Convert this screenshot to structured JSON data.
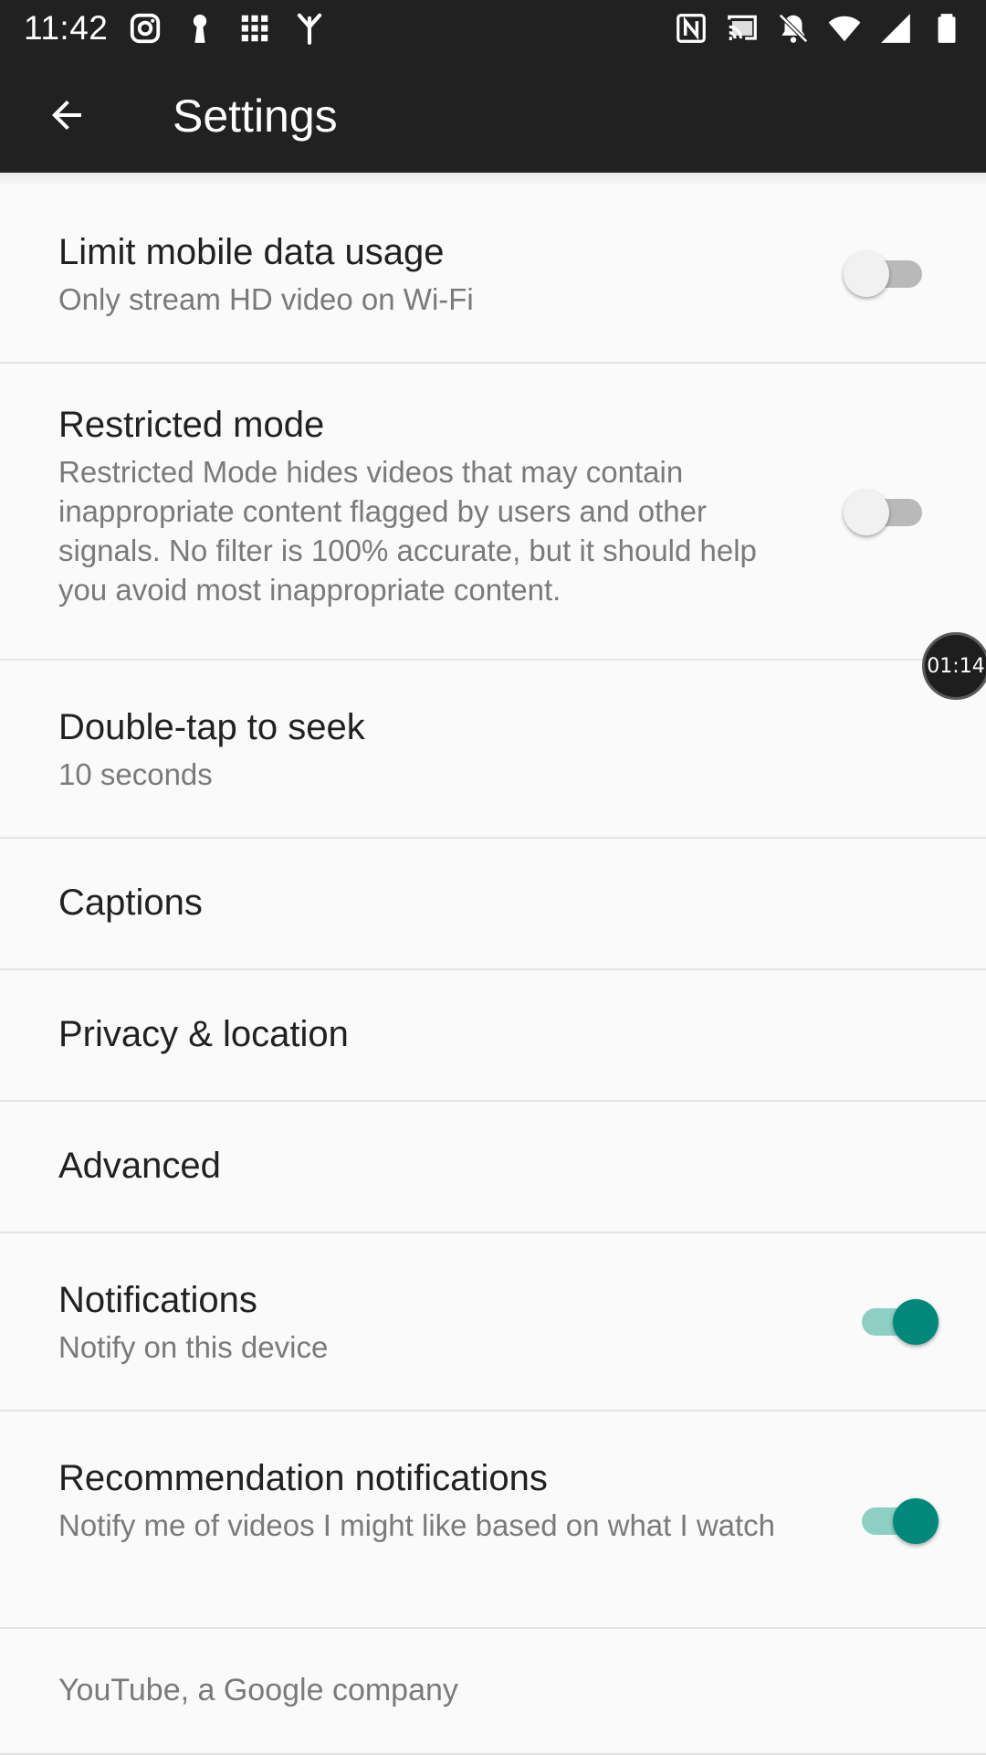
{
  "status_bar": {
    "time": "11:42",
    "left_icons": [
      "instagram-icon",
      "keyhole-icon",
      "grid-icon",
      "fork-icon"
    ],
    "right_icons": [
      "nfc-icon",
      "cast-icon",
      "notifications-off-icon",
      "wifi-icon",
      "signal-icon",
      "battery-icon"
    ]
  },
  "app_bar": {
    "title": "Settings",
    "back_icon": "arrow-back-icon"
  },
  "settings": [
    {
      "title": "Limit mobile data usage",
      "subtitle": "Only stream HD video on Wi-Fi",
      "toggle": "off"
    },
    {
      "title": "Restricted mode",
      "subtitle": "Restricted Mode hides videos that may contain inappropriate content flagged by users and other signals. No filter is 100% accurate, but it should help you avoid most inappropriate content.",
      "toggle": "off"
    },
    {
      "title": "Double-tap to seek",
      "subtitle": "10 seconds"
    },
    {
      "title": "Captions"
    },
    {
      "title": "Privacy & location"
    },
    {
      "title": "Advanced"
    },
    {
      "title": "Notifications",
      "subtitle": "Notify on this device",
      "toggle": "on"
    },
    {
      "title": "Recommendation notifications",
      "subtitle": "Notify me of videos I might like based on what I watch",
      "toggle": "on"
    }
  ],
  "footer": "YouTube, a Google company",
  "timer_bubble": "01:14",
  "colors": {
    "bar_background": "#212121",
    "toggle_on_thumb": "#00897b",
    "toggle_on_track": "#8dcfc5",
    "toggle_off_thumb": "#f1f1f1",
    "toggle_off_track": "#b9b9b9"
  }
}
